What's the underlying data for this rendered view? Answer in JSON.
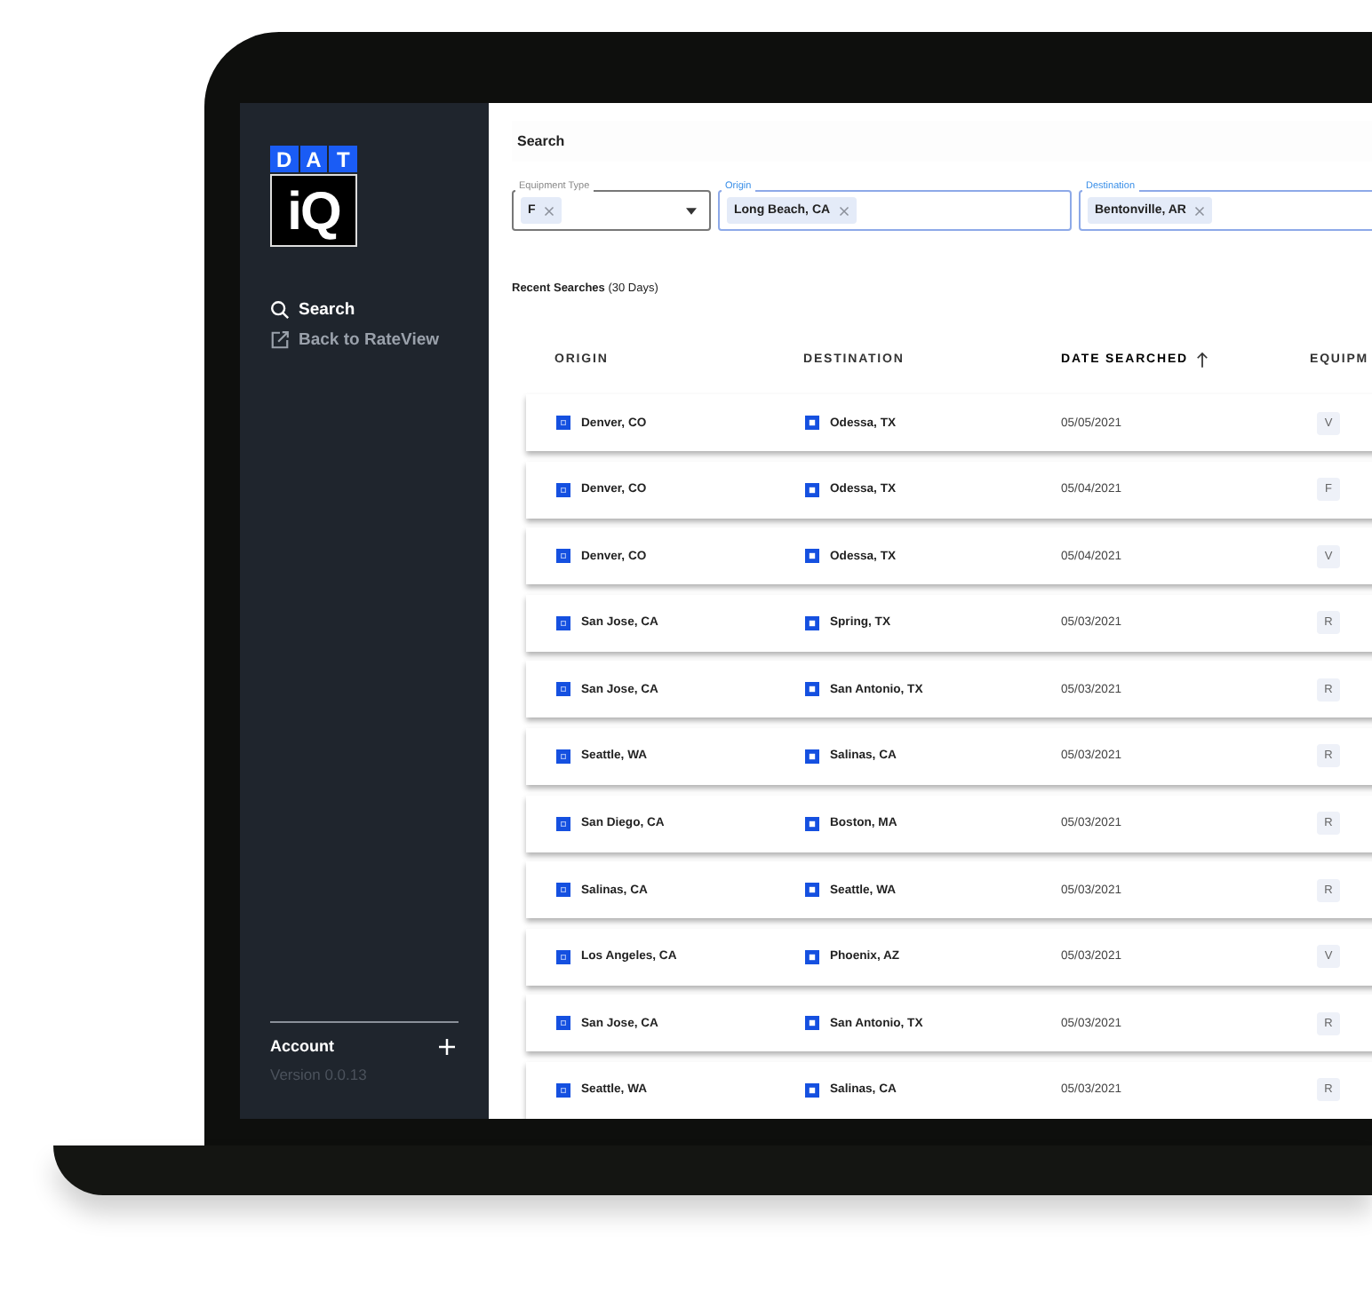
{
  "sidebar": {
    "logo": {
      "top": [
        "D",
        "A",
        "T"
      ],
      "bottom": "iQ"
    },
    "nav": [
      {
        "label": "Search",
        "kind": "search",
        "selected": true
      },
      {
        "label": "Back to RateView",
        "kind": "external",
        "selected": false
      }
    ],
    "account": "Account",
    "version": "Version 0.0.13"
  },
  "search": {
    "title": "Search",
    "filters": [
      {
        "label": "Equipment Type",
        "kind": "select",
        "highlighted": false,
        "chips": [
          "F"
        ]
      },
      {
        "label": "Origin",
        "kind": "location",
        "highlighted": true,
        "chips": [
          "Long Beach, CA"
        ]
      },
      {
        "label": "Destination",
        "kind": "location",
        "highlighted": true,
        "chips": [
          "Bentonville, AR"
        ]
      }
    ]
  },
  "recent": {
    "title": "**Recent Searches** (30 Days)",
    "columns": [
      {
        "label": "ORIGIN",
        "sorted": false
      },
      {
        "label": "DESTINATION",
        "sorted": false
      },
      {
        "label": "DATE SEARCHED",
        "sorted": true
      },
      {
        "label": "EQUIPM",
        "sorted": false
      }
    ],
    "rows": [
      {
        "origin": "Denver, CO",
        "destination": "Odessa, TX",
        "date": "05/05/2021",
        "equipment": "V"
      },
      {
        "origin": "Denver, CO",
        "destination": "Odessa, TX",
        "date": "05/04/2021",
        "equipment": "F"
      },
      {
        "origin": "Denver, CO",
        "destination": "Odessa, TX",
        "date": "05/04/2021",
        "equipment": "V"
      },
      {
        "origin": "San Jose, CA",
        "destination": "Spring, TX",
        "date": "05/03/2021",
        "equipment": "R"
      },
      {
        "origin": "San Jose, CA",
        "destination": "San Antonio, TX",
        "date": "05/03/2021",
        "equipment": "R"
      },
      {
        "origin": "Seattle, WA",
        "destination": "Salinas, CA",
        "date": "05/03/2021",
        "equipment": "R"
      },
      {
        "origin": "San Diego, CA",
        "destination": "Boston, MA",
        "date": "05/03/2021",
        "equipment": "R"
      },
      {
        "origin": "Salinas, CA",
        "destination": "Seattle, WA",
        "date": "05/03/2021",
        "equipment": "R"
      },
      {
        "origin": "Los Angeles, CA",
        "destination": "Phoenix, AZ",
        "date": "05/03/2021",
        "equipment": "V"
      },
      {
        "origin": "San Jose, CA",
        "destination": "San Antonio, TX",
        "date": "05/03/2021",
        "equipment": "R"
      },
      {
        "origin": "Seattle, WA",
        "destination": "Salinas, CA",
        "date": "05/03/2021",
        "equipment": "R"
      }
    ]
  }
}
